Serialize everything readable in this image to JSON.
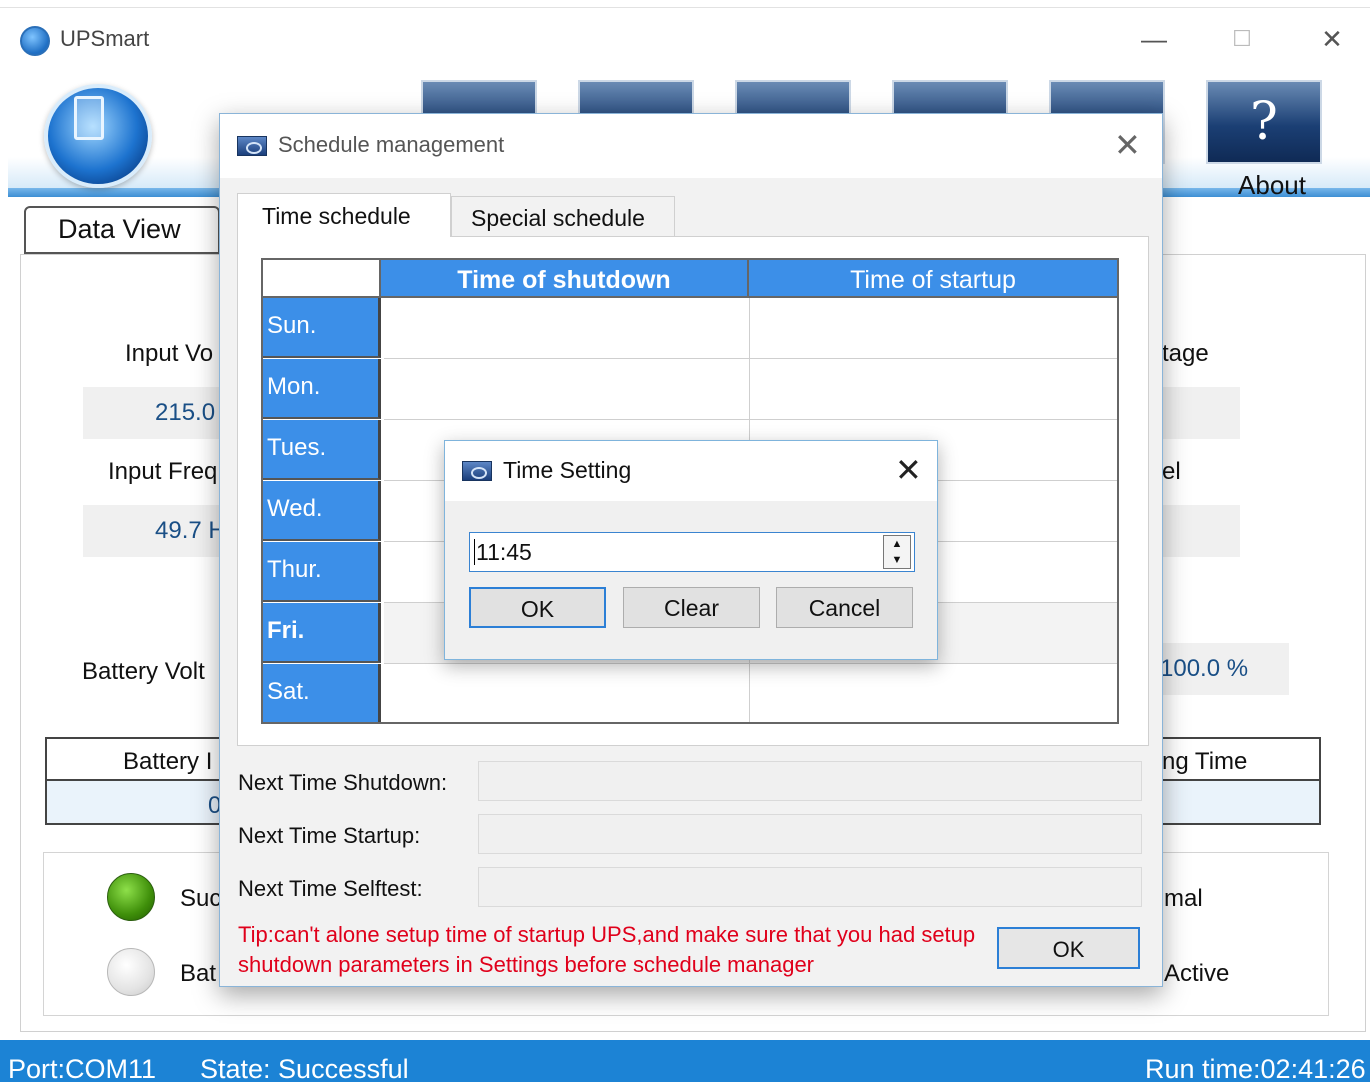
{
  "window": {
    "title": "UPSmart",
    "minimize_glyph": "—",
    "maximize_glyph": "☐",
    "close_glyph": "✕"
  },
  "toolbar": {
    "about_label": "About",
    "about_glyph": "?"
  },
  "main_tab": {
    "label": "Data View"
  },
  "data_view": {
    "input_voltage_label": "Input Vo",
    "input_voltage_value": "215.0",
    "input_frequency_label": "Input Freq",
    "input_frequency_value": "49.7 H",
    "battery_voltage_label": "Battery Volt",
    "right_voltage_label": "tage",
    "right_level_label": "el",
    "right_percent_value": "100.0 %",
    "battery_table_header_left": "Battery I",
    "battery_table_header_right": "ng Time",
    "battery_table_value_left": "0",
    "status_success_label": "Suc",
    "status_battery_label": "Bat",
    "status_normal_label": "mal",
    "status_active_label": "Active"
  },
  "status_bar": {
    "port": "Port:COM11",
    "state": "State: Successful",
    "run_time": "Run time:02:41:26"
  },
  "schedule_dialog": {
    "title": "Schedule management",
    "close_glyph": "✕",
    "tabs": [
      "Time schedule",
      "Special schedule"
    ],
    "columns": [
      "Time of shutdown",
      "Time of startup"
    ],
    "days": [
      "Sun.",
      "Mon.",
      "Tues.",
      "Wed.",
      "Thur.",
      "Fri.",
      "Sat."
    ],
    "next_shutdown_label": "Next Time Shutdown:",
    "next_startup_label": "Next Time Startup:",
    "next_selftest_label": "Next Time Selftest:",
    "tip": "Tip:can't alone setup time of startup UPS,and make sure that you had setup shutdown parameters in Settings before schedule manager",
    "ok_label": "OK"
  },
  "time_setting_dialog": {
    "title": "Time Setting",
    "close_glyph": "✕",
    "time_value": "11:45",
    "spin_up": "▲",
    "spin_down": "▼",
    "ok_label": "OK",
    "clear_label": "Clear",
    "cancel_label": "Cancel"
  },
  "colors": {
    "accent_blue": "#3c8fe8",
    "statusbar_blue": "#1c83d5",
    "tip_red": "#e0001b",
    "led_green": "#3f8f0a"
  },
  "icons": [
    "upsmart-app-icon",
    "upsmart-logo",
    "toolbar-about-icon",
    "schedule-window-icon",
    "time-setting-window-icon"
  ]
}
